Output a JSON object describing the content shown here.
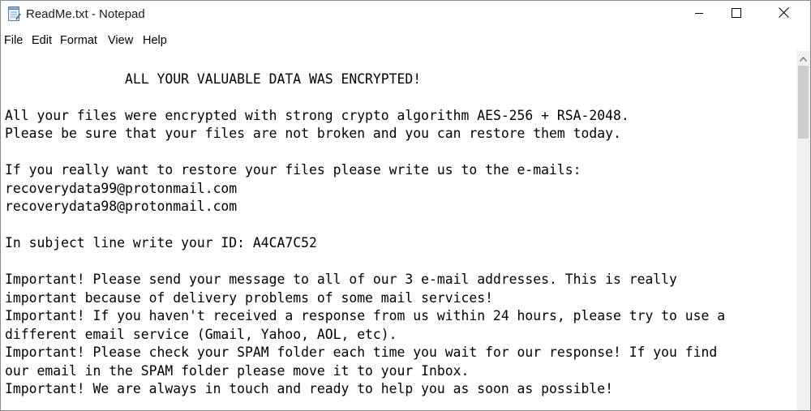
{
  "window": {
    "title": "ReadMe.txt - Notepad"
  },
  "title_icons": {
    "app": "notepad-icon",
    "minimize": "minimize-icon",
    "maximize": "maximize-icon",
    "close": "close-icon"
  },
  "menu": {
    "file": "File",
    "edit": "Edit",
    "format": "Format",
    "view": "View",
    "help": "Help"
  },
  "document": {
    "lines": [
      "               ALL YOUR VALUABLE DATA WAS ENCRYPTED!",
      "",
      "All your files were encrypted with strong crypto algorithm AES-256 + RSA-2048.",
      "Please be sure that your files are not broken and you can restore them today.",
      "",
      "If you really want to restore your files please write us to the e-mails:",
      "recoverydata99@protonmail.com",
      "recoverydata98@protonmail.com",
      "",
      "In subject line write your ID: A4CA7C52",
      "",
      "Important! Please send your message to all of our 3 e-mail addresses. This is really",
      "important because of delivery problems of some mail services!",
      "Important! If you haven't received a response from us within 24 hours, please try to use a",
      "different email service (Gmail, Yahoo, AOL, etc).",
      "Important! Please check your SPAM folder each time you wait for our response! If you find",
      "our email in the SPAM folder please move it to your Inbox.",
      "Important! We are always in touch and ready to help you as soon as possible!"
    ]
  },
  "colors": {
    "title_bar": "#ffffff",
    "text": "#000000",
    "scrollbar_track": "#f0f0f0",
    "scrollbar_thumb": "#cdcdcd"
  }
}
